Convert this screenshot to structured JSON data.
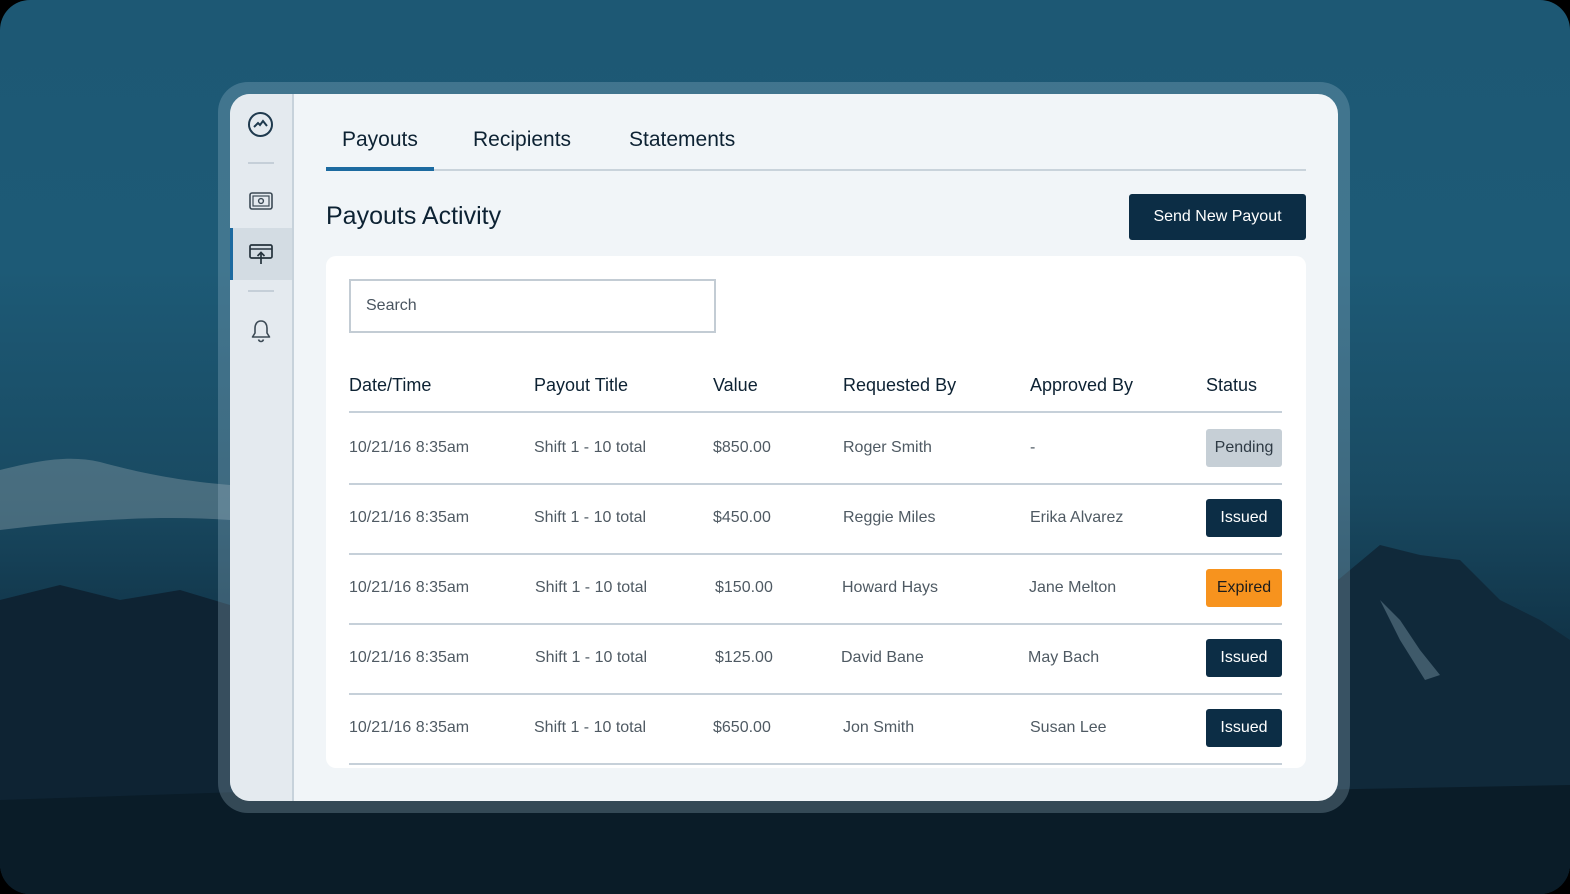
{
  "tabs": [
    {
      "label": "Payouts",
      "active": true
    },
    {
      "label": "Recipients",
      "active": false
    },
    {
      "label": "Statements",
      "active": false
    }
  ],
  "sidebar": {
    "items": [
      {
        "icon": "cash-icon",
        "active": false
      },
      {
        "icon": "payout-upload-icon",
        "active": true
      },
      {
        "icon": "bell-icon",
        "active": false
      }
    ]
  },
  "page": {
    "title": "Payouts Activity",
    "primary_button": "Send New Payout"
  },
  "search": {
    "placeholder": "Search",
    "value": ""
  },
  "table": {
    "columns": [
      "Date/Time",
      "Payout Title",
      "Value",
      "Requested By",
      "Approved By",
      "Status"
    ],
    "rows": [
      {
        "date": "10/21/16 8:35am",
        "title": "Shift 1 - 10 total",
        "value": "$850.00",
        "requested_by": "Roger Smith",
        "approved_by": "-",
        "status": "Pending"
      },
      {
        "date": "10/21/16 8:35am",
        "title": "Shift 1 - 10 total",
        "value": "$450.00",
        "requested_by": "Reggie Miles",
        "approved_by": "Erika Alvarez",
        "status": "Issued"
      },
      {
        "date": "10/21/16 8:35am",
        "title": "Shift 1 - 10 total",
        "value": "$150.00",
        "requested_by": "Howard Hays",
        "approved_by": "Jane Melton",
        "status": "Expired"
      },
      {
        "date": "10/21/16 8:35am",
        "title": "Shift 1 - 10 total",
        "value": "$125.00",
        "requested_by": "David Bane",
        "approved_by": "May Bach",
        "status": "Issued"
      },
      {
        "date": "10/21/16 8:35am",
        "title": "Shift 1 - 10 total",
        "value": "$650.00",
        "requested_by": "Jon Smith",
        "approved_by": "Susan Lee",
        "status": "Issued"
      }
    ]
  },
  "colors": {
    "accent": "#1c6aa0",
    "primary_button": "#0c2d45",
    "status_pending": "#c6cfd6",
    "status_issued": "#0c2d45",
    "status_expired": "#f7931e"
  }
}
